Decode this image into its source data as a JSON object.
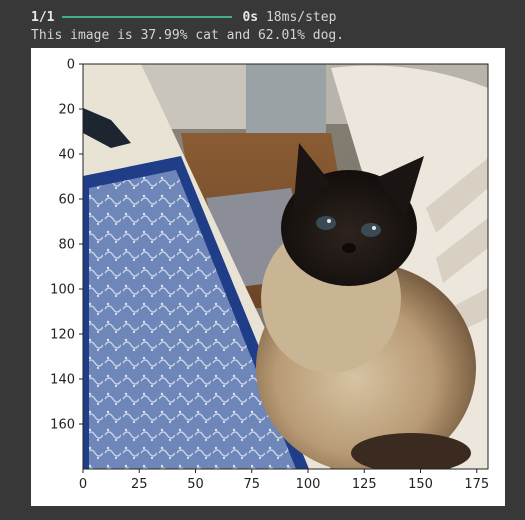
{
  "log": {
    "step_count": "1/1",
    "progress": 1.0,
    "duration": "0s",
    "per_step": "18ms/step"
  },
  "result": {
    "text": "This image is 37.99% cat and 62.01% dog."
  },
  "colors": {
    "progress_bar": "#3fb08a",
    "axis": "#222222"
  },
  "plot": {
    "image_description_icon": "siamese-cat-photo",
    "x_ticks": [
      "0",
      "25",
      "50",
      "75",
      "100",
      "125",
      "150",
      "175"
    ],
    "y_ticks": [
      "0",
      "20",
      "40",
      "60",
      "80",
      "100",
      "120",
      "140",
      "160"
    ],
    "xlim": [
      0,
      180
    ],
    "ylim": [
      180,
      0
    ]
  }
}
